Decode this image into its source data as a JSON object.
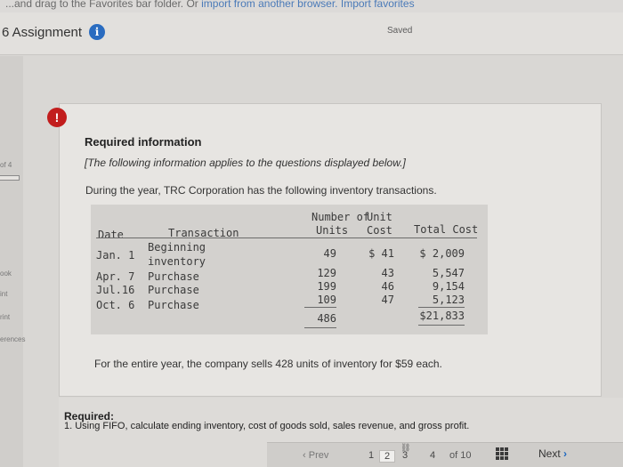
{
  "browser_banner": {
    "text": "...and drag to the Favorites bar folder. Or",
    "link": "import from another browser.",
    "link2": "Import favorites"
  },
  "header": {
    "title": "6 Assignment",
    "info_icon": "info-icon",
    "saved": "Saved"
  },
  "left_rail": {
    "q_label": "of 4",
    "book": "ook",
    "hint": "int",
    "print": "rint",
    "references": "erences"
  },
  "question": {
    "alert_icon": "!",
    "heading": "Required information",
    "note": "[The following information applies to the questions displayed below.]",
    "intro": "During the year, TRC Corporation has the following inventory transactions."
  },
  "table": {
    "headers": {
      "date": "Date",
      "transaction": "Transaction",
      "units_line1": "Number of",
      "units_line2": "Units",
      "cost_line1": "Unit",
      "cost_line2": "Cost",
      "total": "Total Cost"
    },
    "rows": [
      {
        "date": "Jan. 1",
        "trans1": "Beginning",
        "trans2": "inventory",
        "units": "49",
        "cost": "$ 41",
        "total": "$ 2,009"
      },
      {
        "date": "Apr. 7",
        "trans": "Purchase",
        "units": "129",
        "cost": "43",
        "total": "5,547"
      },
      {
        "date": "Jul.16",
        "trans": "Purchase",
        "units": "199",
        "cost": "46",
        "total": "9,154"
      },
      {
        "date": "Oct. 6",
        "trans": "Purchase",
        "units": "109",
        "cost": "47",
        "total": "5,123"
      }
    ],
    "total_units": "486",
    "total_cost": "$21,833"
  },
  "sales_note": "For the entire year, the company sells 428 units of inventory for $59 each.",
  "required": {
    "label": "Required:",
    "item": "1. Using FIFO, calculate ending inventory, cost of goods sold, sales revenue, and gross profit."
  },
  "pager": {
    "prev": "Prev",
    "pages": [
      "1",
      "2",
      "3",
      "4"
    ],
    "current": "2",
    "of": "of 10",
    "next": "Next",
    "link_icon": "link-icon",
    "grid_icon": "grid-icon"
  }
}
